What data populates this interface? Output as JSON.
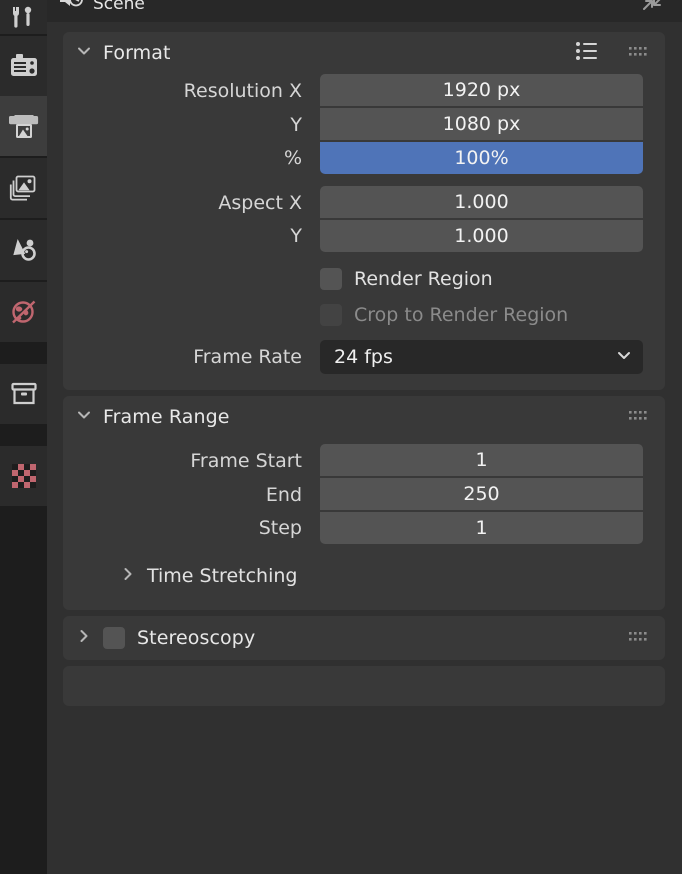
{
  "breadcrumb": {
    "scene_label": "Scene",
    "scene_icon": "scene-render-icon",
    "expand_icon": "expand-arrows-icon"
  },
  "tabbar": {
    "items": [
      {
        "name": "tool-properties",
        "icon": "tool-screwdriver-wrench-icon",
        "active": false,
        "accent": "#cfcfcf"
      },
      {
        "name": "render-properties",
        "icon": "camera-back-icon",
        "active": false,
        "accent": "#cfcfcf"
      },
      {
        "name": "output-properties",
        "icon": "printer-icon",
        "active": true,
        "accent": "#cfcfcf"
      },
      {
        "name": "view-layer-properties",
        "icon": "images-stack-icon",
        "active": false,
        "accent": "#cfcfcf"
      },
      {
        "name": "scene-properties",
        "icon": "cone-sphere-icon",
        "active": false,
        "accent": "#cfcfcf"
      },
      {
        "name": "world-properties",
        "icon": "globe-icon",
        "active": false,
        "accent": "#c0666f"
      },
      {
        "name": "collection-properties",
        "icon": "box-archive-icon",
        "active": false,
        "accent": "#cfcfcf"
      },
      {
        "name": "texture-properties",
        "icon": "checker-texture-icon",
        "active": false,
        "accent": "#c0666f"
      }
    ]
  },
  "format_panel": {
    "title": "Format",
    "expanded": true,
    "chevron_icon": "chevron-down-icon",
    "presets_icon": "presets-list-icon",
    "grip_icon": "grip-dots-icon",
    "fields": [
      {
        "label": "Resolution X",
        "value": "1920 px",
        "type": "number"
      },
      {
        "label": "Y",
        "value": "1080 px",
        "type": "number"
      },
      {
        "label": "%",
        "value": "100%",
        "type": "slider",
        "fill_color": "#4f74b8"
      }
    ],
    "aspect": [
      {
        "label": "Aspect X",
        "value": "1.000",
        "type": "number"
      },
      {
        "label": "Y",
        "value": "1.000",
        "type": "number"
      }
    ],
    "checkboxes": [
      {
        "label": "Render Region",
        "checked": false,
        "enabled": true
      },
      {
        "label": "Crop to Render Region",
        "checked": false,
        "enabled": false
      }
    ],
    "frame_rate": {
      "label": "Frame Rate",
      "value": "24 fps",
      "chevron_icon": "chevron-down-icon"
    }
  },
  "frame_range_panel": {
    "title": "Frame Range",
    "expanded": true,
    "chevron_icon": "chevron-down-icon",
    "grip_icon": "grip-dots-icon",
    "fields": [
      {
        "label": "Frame Start",
        "value": "1"
      },
      {
        "label": "End",
        "value": "250"
      },
      {
        "label": "Step",
        "value": "1"
      }
    ],
    "subpanel": {
      "title": "Time Stretching",
      "expanded": false,
      "chevron_icon": "chevron-right-icon"
    }
  },
  "stereoscopy_panel": {
    "title": "Stereoscopy",
    "expanded": false,
    "checked": false,
    "chevron_icon": "chevron-right-icon",
    "grip_icon": "grip-dots-icon"
  },
  "theme": {
    "window_bg": "#303030",
    "panel_bg": "#393939",
    "tabbar_bg": "#1d1d1d",
    "tab_bg": "#2b2b2b",
    "tab_active_bg": "#3d3d3d",
    "field_bg": "#545454",
    "dropdown_bg": "#282828",
    "text": "#d6d6d6",
    "text_dim": "#8e8e8e",
    "accent_blue": "#4f74b8",
    "accent_red": "#c0666f"
  }
}
